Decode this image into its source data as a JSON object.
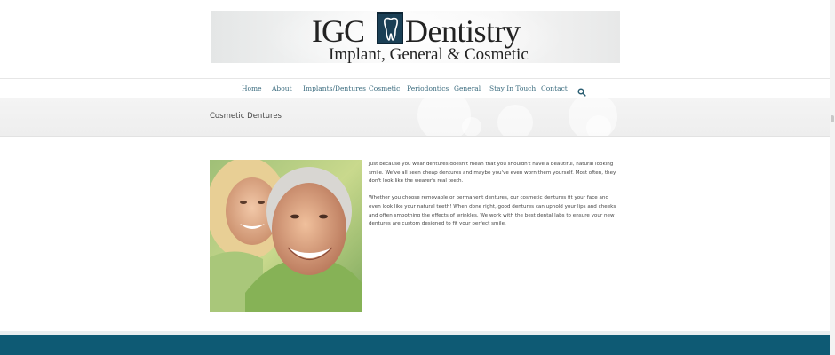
{
  "logo": {
    "word1": "IGC",
    "word2": "Dentistry",
    "tagline": "Implant, General & Cosmetic",
    "tooth_icon": "tooth-icon"
  },
  "nav": {
    "items": [
      {
        "label": "Home"
      },
      {
        "label": "About"
      },
      {
        "label": "Implants/Dentures"
      },
      {
        "label": "Cosmetic"
      },
      {
        "label": "Periodontics"
      },
      {
        "label": "General"
      },
      {
        "label": "Stay In Touch"
      },
      {
        "label": "Contact"
      }
    ],
    "search_icon": "search-icon"
  },
  "page": {
    "title": "Cosmetic Dentures",
    "paragraphs": [
      "Just because you wear dentures doesn't mean that you shouldn't have a beautiful, natural looking smile. We've all seen cheap dentures and maybe you've even worn them yourself. Most often, they don't look like the wearer's real teeth.",
      "Whether you choose removable or permanent dentures, our cosmetic dentures fit your face and even look like your natural teeth! When done right, good dentures can uphold your lips and cheeks and often smoothing the effects of wrinkles. We work with the best dental labs to ensure your new dentures are custom designed to fit your perfect smile."
    ]
  },
  "colors": {
    "nav_link": "#3a6b7e",
    "footer": "#0e5a74",
    "logo_box": "#1a3f55"
  }
}
